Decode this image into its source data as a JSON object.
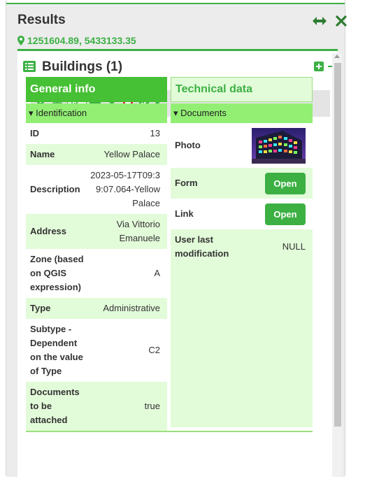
{
  "results": {
    "title": "Results",
    "coordinates": "1251604.89, 5433133.35"
  },
  "card": {
    "title": "Buildings (1)"
  },
  "toolbar": {
    "icons": [
      "map-marker-icon",
      "hierarchy-icon",
      "chart-icon",
      "print-icon",
      "download-icon",
      "remove-icon",
      "check-icon",
      "share-icon"
    ]
  },
  "tabs": {
    "general": "General info",
    "technical": "Technical data"
  },
  "left_section": "▾ Identification",
  "fields": [
    {
      "label": "ID",
      "value": "13"
    },
    {
      "label": "Name",
      "value": "Yellow Palace"
    },
    {
      "label": "Description",
      "value": "2023-05-17T09:39:07.064-Yellow Palace"
    },
    {
      "label": "Address",
      "value": "Via Vittorio Emanuele"
    },
    {
      "label": "Zone (based on QGIS expression)",
      "value": "A"
    },
    {
      "label": "Type",
      "value": "Administrative"
    },
    {
      "label": "Subtype - Dependent on the value of Type",
      "value": "C2"
    },
    {
      "label": "Documents to be attached",
      "value": "true"
    }
  ],
  "right_section": "▾ Documents",
  "documents": {
    "photo_label": "Photo",
    "form_label": "Form",
    "form_button": "Open",
    "link_label": "Link",
    "link_button": "Open",
    "user_mod_label": "User last modification",
    "user_mod_value": "NULL"
  },
  "colors": {
    "accent": "#3cb043",
    "section": "#92ef74",
    "light": "#e2fbd9",
    "remove": "#e8212b"
  }
}
